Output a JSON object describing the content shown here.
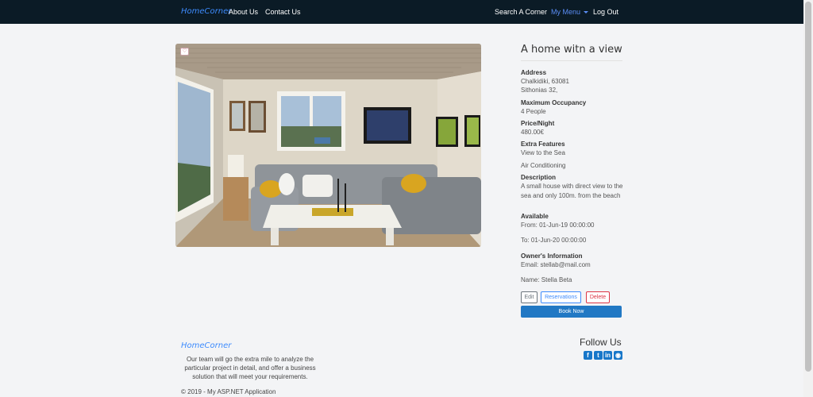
{
  "nav": {
    "brand": "HomeCorner",
    "about": "About Us",
    "contact": "Contact Us",
    "search": "Search A Corner",
    "menu": "My Menu",
    "logout": "Log Out"
  },
  "listing": {
    "title": "A home witn a view",
    "address_label": "Address",
    "address_line1": "Chalkidiki, 63081",
    "address_line2": "Sithonias 32,",
    "occupancy_label": "Maximum Occupancy",
    "occupancy_value": "4 People",
    "price_label": "Price/Night",
    "price_value": "480.00€",
    "features_label": "Extra Features",
    "features": [
      "View to the Sea",
      "Air Conditioning"
    ],
    "description_label": "Description",
    "description": "A small house with direct view to the sea and only 100m. from the beach",
    "available_label": "Available",
    "available_from": "From: 01-Jun-19 00:00:00",
    "available_to": "To: 01-Jun-20 00:00:00",
    "owner_label": "Owner's Information",
    "owner_email": "Email: stellab@mail.com",
    "owner_name": "Name: Stella Beta"
  },
  "actions": {
    "edit": "Edit",
    "reservations": "Reservations",
    "delete": "Delete",
    "book": "Book Now"
  },
  "footer": {
    "brand": "HomeCorner",
    "text": "Our team will go the extra mile to analyze the particular project in detail, and offer a business solution that will meet your requirements.",
    "copyright": "© 2019 - My ASP.NET Application",
    "follow": "Follow Us",
    "social_icons": [
      "facebook-icon",
      "twitter-icon",
      "linkedin-icon",
      "github-icon"
    ]
  },
  "colors": {
    "navbar": "#0b1b26",
    "brand": "#3d8bfd",
    "primary": "#2178c4",
    "danger": "#dc3545"
  }
}
